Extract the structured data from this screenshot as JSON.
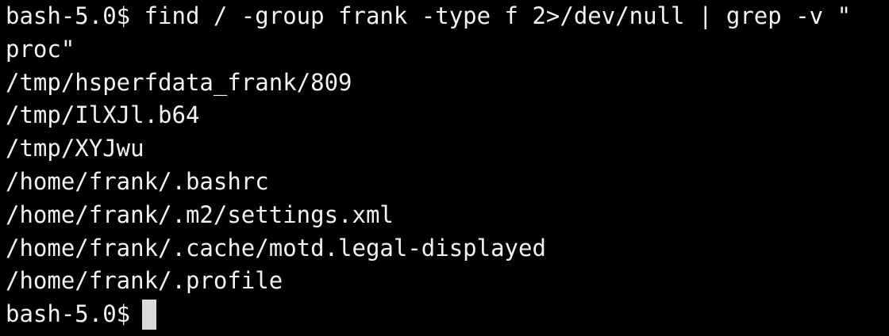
{
  "terminal": {
    "command_line_1": "bash-5.0$ find / -group frank -type f 2>/dev/null | grep -v \"",
    "command_line_2": "proc\"",
    "output": [
      "/tmp/hsperfdata_frank/809",
      "/tmp/IlXJl.b64",
      "/tmp/XYJwu",
      "/home/frank/.bashrc",
      "/home/frank/.m2/settings.xml",
      "/home/frank/.cache/motd.legal-displayed",
      "/home/frank/.profile"
    ],
    "prompt": "bash-5.0$",
    "colors": {
      "background": "#000000",
      "text": "#f2f2f2",
      "cursor": "#d9d9d9"
    }
  }
}
